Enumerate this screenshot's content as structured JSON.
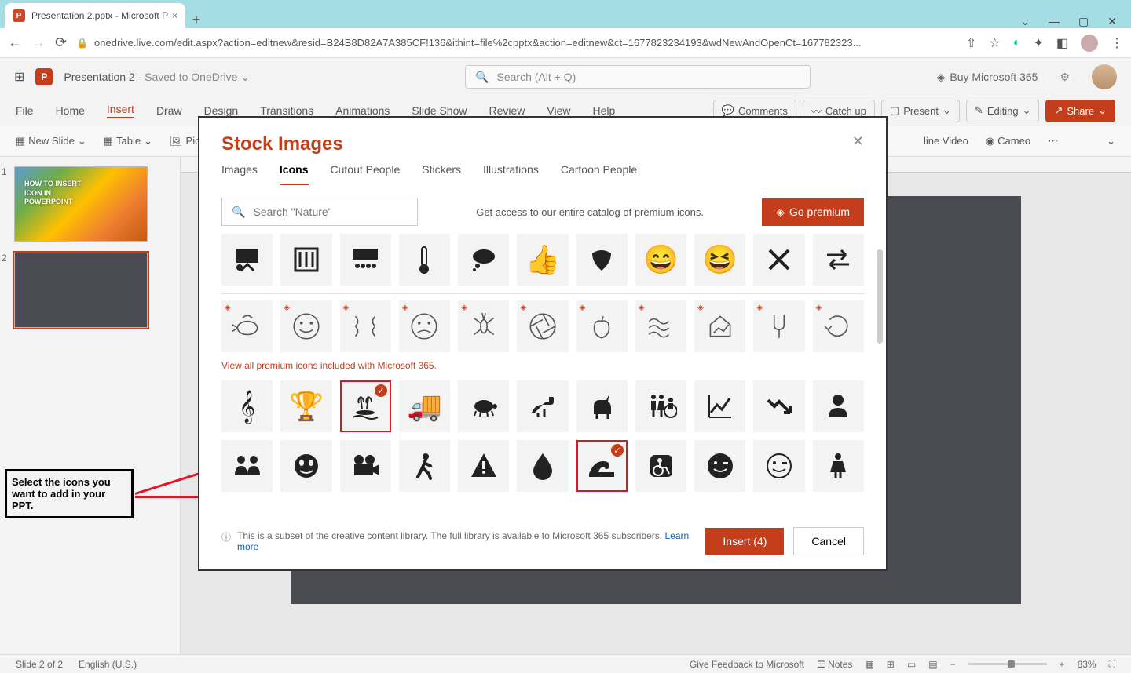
{
  "browser": {
    "tab_title": "Presentation 2.pptx - Microsoft P",
    "new_tab": "+",
    "address": "onedrive.live.com/edit.aspx?action=editnew&resid=B24B8D82A7A385CF!136&ithint=file%2cpptx&action=editnew&ct=1677823234193&wdNewAndOpenCt=167782323...",
    "close_glyph": "×"
  },
  "ppt": {
    "doc_name": "Presentation 2",
    "save_state": " - Saved to OneDrive",
    "search_placeholder": "Search (Alt + Q)",
    "buy": "Buy Microsoft 365"
  },
  "menu": {
    "items": [
      "File",
      "Home",
      "Insert",
      "Draw",
      "Design",
      "Transitions",
      "Animations",
      "Slide Show",
      "Review",
      "View",
      "Help"
    ],
    "active": "Insert",
    "comments": "Comments",
    "catchup": "Catch up",
    "present": "Present",
    "editing": "Editing",
    "share": "Share"
  },
  "ribbon": {
    "new_slide": "New Slide",
    "table": "Table",
    "picture_partial": "Pic",
    "online_video_partial": "line Video",
    "cameo": "Cameo"
  },
  "thumbs": {
    "s1": {
      "n": "1",
      "text": "HOW TO INSERT\nICON IN\nPOWERPOINT"
    },
    "s2": {
      "n": "2"
    }
  },
  "instruction": "Select the icons you want to add in your PPT.",
  "status": {
    "slide": "Slide 2 of 2",
    "lang": "English (U.S.)",
    "feedback": "Give Feedback to Microsoft",
    "notes": "Notes",
    "zoom": "83%"
  },
  "dialog": {
    "title": "Stock Images",
    "tabs": [
      "Images",
      "Icons",
      "Cutout People",
      "Stickers",
      "Illustrations",
      "Cartoon People"
    ],
    "active_tab": "Icons",
    "search_placeholder": "Search \"Nature\"",
    "premium_banner": "Get access to our entire catalog of premium icons.",
    "go_premium": "Go premium",
    "view_all": "View all premium icons included with Microsoft 365.",
    "footer_text": "This is a subset of the creative content library. The full library is available to Microsoft 365 subscribers. ",
    "learn_more": "Learn more",
    "insert": "Insert (4)",
    "cancel": "Cancel",
    "row1": [
      "presentation-screen",
      "test-tubes",
      "theater",
      "thermometer",
      "thought-cloud",
      "thumbs-up",
      "tongue",
      "grin-emoji",
      "crazy-emoji",
      "tools-cross",
      "arrows-swap"
    ],
    "row2_premium": [
      "clownfish",
      "smile-outline",
      "compress",
      "frown",
      "mosquito",
      "aperture",
      "apple",
      "waves-chart",
      "house-chart",
      "tuning-fork",
      "recycle"
    ],
    "row3": [
      "treble-clef",
      "trophy",
      "palm-island",
      "truck",
      "turtle",
      "dinosaur",
      "unicorn",
      "restroom",
      "line-chart-up",
      "trend-down",
      "user"
    ],
    "row4": [
      "people-group",
      "globe-face",
      "video-camera",
      "walking",
      "warning",
      "water-drop",
      "wave",
      "wheelchair",
      "wink-solid",
      "wink-outline",
      "woman"
    ],
    "selected": [
      "palm-island",
      "wave"
    ]
  }
}
